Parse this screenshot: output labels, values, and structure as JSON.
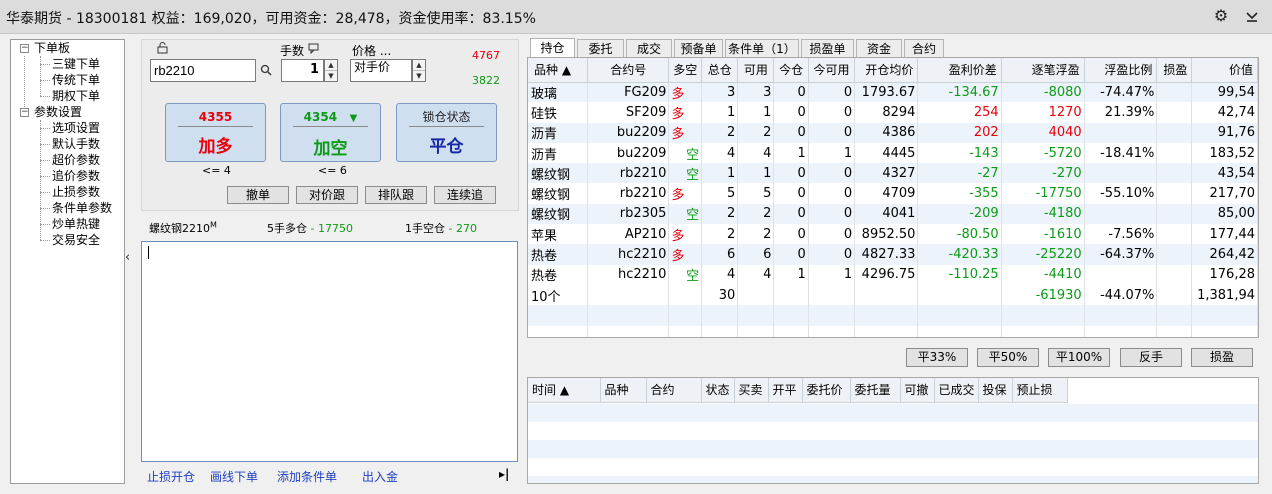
{
  "window": {
    "title": "华泰期货 - 18300181 权益：169,020，可用资金：28,478，资金使用率：83.15%"
  },
  "tree": {
    "group1": {
      "label": "下单板",
      "items": [
        "三键下单",
        "传统下单",
        "期权下单"
      ]
    },
    "group2": {
      "label": "参数设置",
      "items": [
        "选项设置",
        "默认手数",
        "超价参数",
        "追价参数",
        "止损参数",
        "条件单参数",
        "炒单热键",
        "交易安全"
      ]
    }
  },
  "order": {
    "contract": "rb2210",
    "qty_label": "手数",
    "qty": "1",
    "price_label": "价格 ...",
    "price_value": "对手价",
    "ask": "4767",
    "bid": "3822",
    "buy": {
      "price": "4355",
      "action": "加多",
      "limit": "<= 4"
    },
    "sell": {
      "price": "4354",
      "arrow": "▼",
      "action": "加空",
      "limit": "<= 6"
    },
    "lock": {
      "label": "锁仓状态",
      "action": "平仓"
    },
    "buttons": [
      "撤单",
      "对价跟",
      "排队跟",
      "连续追"
    ]
  },
  "position_summary": {
    "name": "螺纹钢2210",
    "sup": "M",
    "long_label": "5手多仓",
    "long_value": "17750",
    "short_label": "1手空仓",
    "short_value": "270"
  },
  "bottom_links": [
    "止损开仓",
    "画线下单",
    "添加条件单",
    "出入金"
  ],
  "end_icon": "▸|",
  "tabs": [
    "持仓",
    "委托",
    "成交",
    "预备单",
    "条件单（1）",
    "损盈单",
    "资金",
    "合约"
  ],
  "positions": {
    "headers": [
      "品种 ▲",
      "合约号",
      "多空",
      "总仓",
      "可用",
      "今仓",
      "今可用",
      "开仓均价",
      "盈利价差",
      "逐笔浮盈",
      "浮盈比例",
      "损盈",
      "价值"
    ],
    "rows": [
      [
        "玻璃",
        "FG209",
        "多",
        "3",
        "3",
        "0",
        "0",
        "1793.67",
        "-134.67",
        "-8080",
        "-74.47%",
        "",
        "99,54"
      ],
      [
        "硅铁",
        "SF209",
        "多",
        "1",
        "1",
        "0",
        "0",
        "8294",
        "254",
        "1270",
        "21.39%",
        "",
        "42,74"
      ],
      [
        "沥青",
        "bu2209",
        "多",
        "2",
        "2",
        "0",
        "0",
        "4386",
        "202",
        "4040",
        "",
        "",
        "91,76"
      ],
      [
        "沥青",
        "bu2209",
        "空",
        "4",
        "4",
        "1",
        "1",
        "4445",
        "-143",
        "-5720",
        "-18.41%",
        "",
        "183,52"
      ],
      [
        "螺纹钢",
        "rb2210",
        "空",
        "1",
        "1",
        "0",
        "0",
        "4327",
        "-27",
        "-270",
        "",
        "",
        "43,54"
      ],
      [
        "螺纹钢",
        "rb2210",
        "多",
        "5",
        "5",
        "0",
        "0",
        "4709",
        "-355",
        "-17750",
        "-55.10%",
        "",
        "217,70"
      ],
      [
        "螺纹钢",
        "rb2305",
        "空",
        "2",
        "2",
        "0",
        "0",
        "4041",
        "-209",
        "-4180",
        "",
        "",
        "85,00"
      ],
      [
        "苹果",
        "AP210",
        "多",
        "2",
        "2",
        "0",
        "0",
        "8952.50",
        "-80.50",
        "-1610",
        "-7.56%",
        "",
        "177,44"
      ],
      [
        "热卷",
        "hc2210",
        "多",
        "6",
        "6",
        "0",
        "0",
        "4827.33",
        "-420.33",
        "-25220",
        "-64.37%",
        "",
        "264,42"
      ],
      [
        "热卷",
        "hc2210",
        "空",
        "4",
        "4",
        "1",
        "1",
        "4296.75",
        "-110.25",
        "-4410",
        "",
        "",
        "176,28"
      ]
    ],
    "total": [
      "10个",
      "",
      "",
      "30",
      "",
      "",
      "",
      "",
      "",
      "-61930",
      "-44.07%",
      "",
      "1,381,94"
    ]
  },
  "actions": [
    "平33%",
    "平50%",
    "平100%",
    "反手",
    "损盈"
  ],
  "orders": {
    "headers": [
      "时间 ▲",
      "品种",
      "合约",
      "状态",
      "买卖",
      "开平",
      "委托价",
      "委托量",
      "可撤",
      "已成交",
      "投保",
      "预止损"
    ]
  },
  "colors": {
    "long": "#e8000b",
    "short": "#0b9b16",
    "link": "#1f3fbf"
  },
  "icons": {
    "settings": "gear-icon",
    "collapse": "chevron-down-icon",
    "lock": "lock-icon",
    "search": "search-icon",
    "qty": "speech-icon"
  }
}
